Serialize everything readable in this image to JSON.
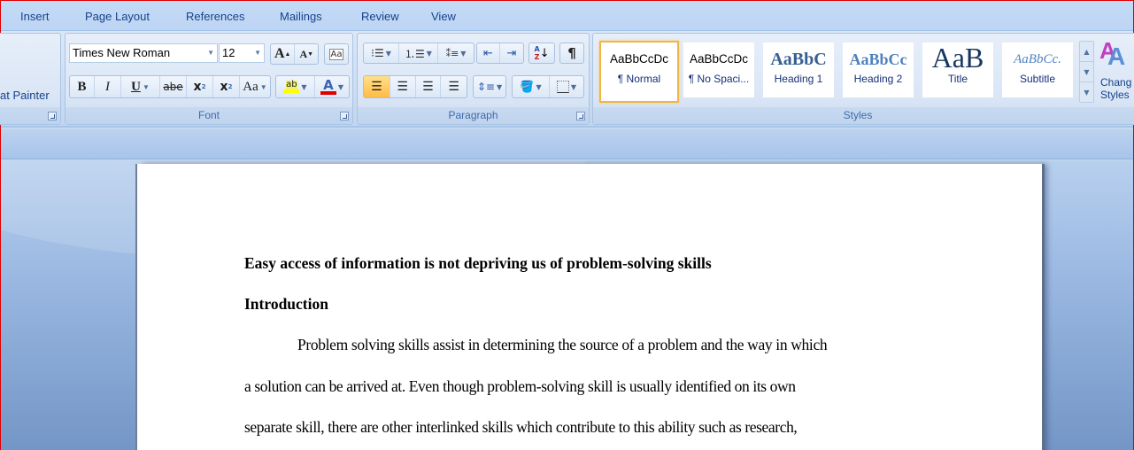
{
  "tabs": [
    "Insert",
    "Page Layout",
    "References",
    "Mailings",
    "Review",
    "View"
  ],
  "clipboard": {
    "format_painter_label": "at Painter"
  },
  "font_group": {
    "label": "Font",
    "font_name": "Times New Roman",
    "font_size": "12",
    "grow_font_icon": "A",
    "shrink_font_icon": "A",
    "bold": "B",
    "italic": "I",
    "underline": "U",
    "strikethrough": "abe",
    "subscript": "x",
    "superscript": "x",
    "change_case": "Aa",
    "highlight_color": "#ffff00",
    "font_color": "#e00000"
  },
  "paragraph_group": {
    "label": "Paragraph",
    "sort_icon_text": "A Z",
    "show_marks": "¶"
  },
  "styles_group": {
    "label": "Styles",
    "styles": [
      {
        "sample": "AaBbCcDc",
        "name": "¶ Normal",
        "selected": true
      },
      {
        "sample": "AaBbCcDc",
        "name": "¶ No Spaci...",
        "selected": false
      },
      {
        "sample": "AaBbC",
        "name": "Heading 1",
        "selected": false
      },
      {
        "sample": "AaBbCc",
        "name": "Heading 2",
        "selected": false
      },
      {
        "sample": "AaB",
        "name": "Title",
        "selected": false
      },
      {
        "sample": "AaBbCc.",
        "name": "Subtitle",
        "selected": false
      }
    ],
    "change_styles_label_1": "Chang",
    "change_styles_label_2": "Styles"
  },
  "document": {
    "title": "Easy access of information is not depriving us of problem-solving  skills",
    "heading": "Introduction",
    "lines": [
      "Problem solving skills assist in determining the source of a problem  and the way in which",
      "a solution can be arrived at. Even though problem-solving  skill is usually identified on its own",
      "separate skill, there are other interlinked skills which contribute to this ability such as research,"
    ]
  }
}
